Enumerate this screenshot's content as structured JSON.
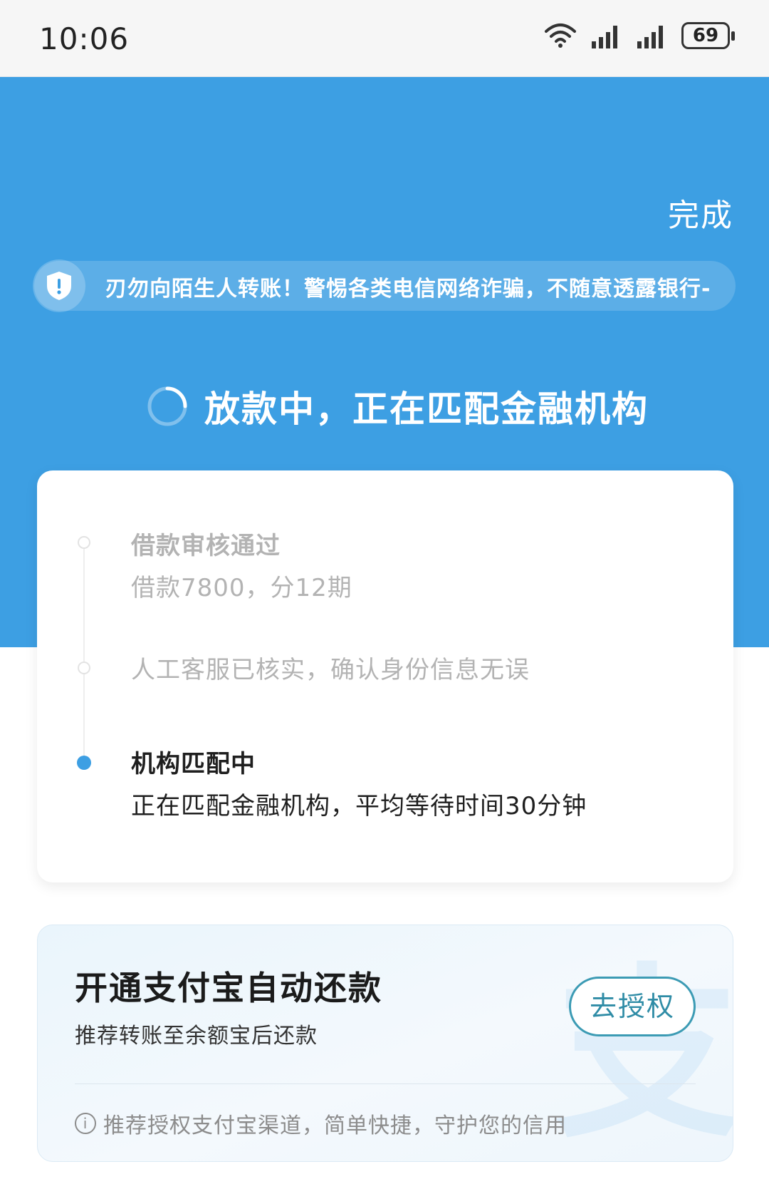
{
  "status_bar": {
    "time": "10:06",
    "battery": "69",
    "icons": [
      "wifi-icon",
      "signal-icon",
      "signal-icon",
      "battery-icon"
    ]
  },
  "header": {
    "done_label": "完成",
    "notice_text": "刃勿向陌生人转账！警惕各类电信网络诈骗，不随意透露银行-",
    "loading_text": "放款中，正在匹配金融机构",
    "bg_color": "#3d9fe3"
  },
  "progress": {
    "steps": [
      {
        "title": "借款审核通过",
        "desc": "借款7800，分12期",
        "state": "done"
      },
      {
        "title": "",
        "desc": "人工客服已核实，确认身份信息无误",
        "state": "done"
      },
      {
        "title": "机构匹配中",
        "desc": "正在匹配金融机构，平均等待时间30分钟",
        "state": "active"
      }
    ]
  },
  "alipay": {
    "title": "开通支付宝自动还款",
    "subtitle": "推荐转账至余额宝后还款",
    "button_label": "去授权",
    "note": "推荐授权支付宝渠道，简单快捷，守护您的信用",
    "watermark": "支"
  }
}
